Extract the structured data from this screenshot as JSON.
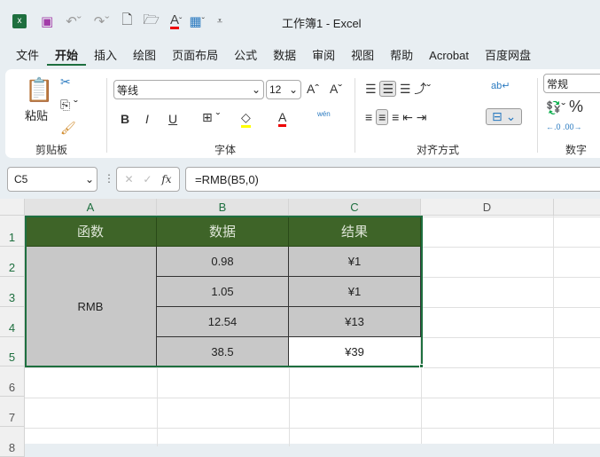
{
  "window": {
    "title": "工作簿1  -  Excel"
  },
  "tabs": [
    "文件",
    "开始",
    "插入",
    "绘图",
    "页面布局",
    "公式",
    "数据",
    "审阅",
    "视图",
    "帮助",
    "Acrobat",
    "百度网盘"
  ],
  "ribbon": {
    "paste": "粘贴",
    "clipboard": "剪贴板",
    "font_name": "等线",
    "font_size": "12",
    "font_group": "字体",
    "align_group": "对齐方式",
    "number_format": "常规",
    "number_group": "数字",
    "bold": "B",
    "italic": "I",
    "underline": "U",
    "wen": "wén"
  },
  "formula_bar": {
    "name_box": "C5",
    "formula": "=RMB(B5,0)",
    "fx": "fx"
  },
  "columns": [
    "A",
    "B",
    "C",
    "D"
  ],
  "rows": [
    "1",
    "2",
    "3",
    "4",
    "5",
    "6",
    "7",
    "8"
  ],
  "table": {
    "headers": [
      "函数",
      "数据",
      "结果"
    ],
    "func": "RMB",
    "data": [
      "0.98",
      "1.05",
      "12.54",
      "38.5"
    ],
    "results": [
      "¥1",
      "¥1",
      "¥13",
      "¥39"
    ]
  },
  "colors": {
    "header_bg": "#3e6428",
    "cell_gray": "#c8c8c8",
    "accent": "#1e6f3f"
  }
}
